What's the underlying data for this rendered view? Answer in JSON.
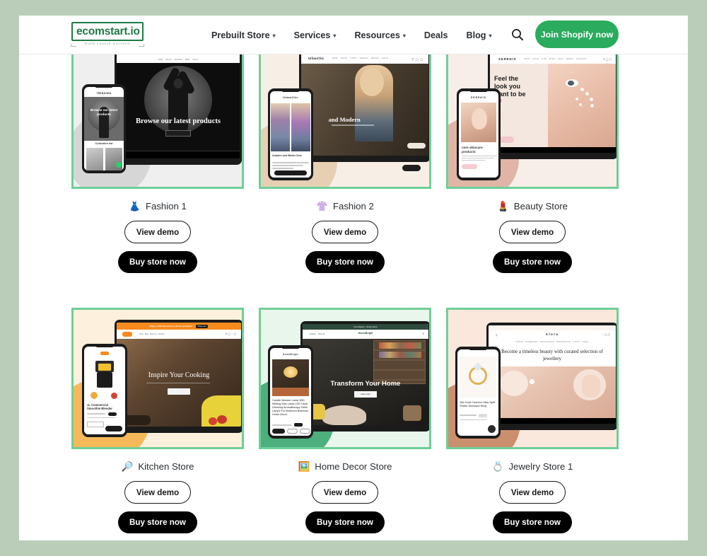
{
  "theme": {
    "page_bg": "#b9cdb9",
    "content_bg": "#ffffff",
    "brand_green": "#1f7a44",
    "cta_green": "#2aab5e",
    "card_border_green": "#6fcf97",
    "button_black": "#000000"
  },
  "header": {
    "logo": {
      "name": "ecomstart.io",
      "tagline": "Build.Launch.Succeed"
    },
    "nav": [
      {
        "label": "Prebuilt Store",
        "has_dropdown": true,
        "caret": "▾"
      },
      {
        "label": "Services",
        "has_dropdown": true,
        "caret": "▾"
      },
      {
        "label": "Resources",
        "has_dropdown": true,
        "caret": "▾"
      },
      {
        "label": "Deals",
        "has_dropdown": false,
        "caret": ""
      },
      {
        "label": "Blog",
        "has_dropdown": true,
        "caret": "▾"
      }
    ],
    "search_icon": "search-icon",
    "cta_label": "Join Shopify now"
  },
  "grid": {
    "view_demo_label": "View demo",
    "buy_store_label": "Buy store now",
    "cards": [
      {
        "id": "fashion-1",
        "emoji": "👗",
        "label": "Fashion 1",
        "store_name": "TRENDORA",
        "hero_text": "Browse our latest products",
        "mobile_text": "Browse our latest products",
        "mobile_section": "Collection list",
        "view_demo": "View demo",
        "buy_store": "Buy store now"
      },
      {
        "id": "fashion-2",
        "emoji": "👚",
        "label": "Fashion 2",
        "store_name": "UrbanChic",
        "hero_text": "and Modern",
        "mobile_text": "Autumn and Winter Sets",
        "mobile_section": "Autumn and Winter Sets",
        "view_demo": "View demo",
        "buy_store": "Buy store now"
      },
      {
        "id": "beauty-store",
        "emoji": "💄",
        "label": "Beauty Store",
        "store_name": "SERENIS",
        "hero_text": "Feel the look you want to be 💗",
        "mobile_text": "core skincare products",
        "mobile_section": "core skincare products",
        "view_demo": "View demo",
        "buy_store": "Buy store now"
      },
      {
        "id": "kitchen-store",
        "emoji": "🔎",
        "label": "Kitchen Store",
        "store_name": "Kitchenly",
        "hero_text": "Inspire Your Cooking",
        "promo_bar": "Enjoy a 10% discount on all our products!",
        "promo_button": "Shop now",
        "mobile_text": "1L Commercial Smoothie Blender",
        "mobile_section": "1L Commercial Smoothie Blender",
        "view_demo": "View demo",
        "buy_store": "Buy store now"
      },
      {
        "id": "home-decor-store",
        "emoji": "🖼️",
        "label": "Home Decor Store",
        "store_name": "HomeBright",
        "hero_text": "Transform Your Home",
        "hero_button": "Learn more",
        "mobile_text": "Candle Warmer Lamp With Melting Wax Lamp LED Lamp Dimming Aromatherapy Table Lamps For Bedroom Bedhead Home Decor",
        "mobile_section": "Candle Warmer Lamp",
        "view_demo": "View demo",
        "buy_store": "Buy store now"
      },
      {
        "id": "jewelry-store-1",
        "emoji": "💍",
        "label": "Jewelry Store 1",
        "store_name": "Alora",
        "hero_text": "Become a timeless beauty with curated selection of jewellery",
        "mobile_text": "18k Gold Cushion Halo Split Shank Diamond Ring",
        "mobile_section": "18k Gold Cushion Halo Split Shank Diamond Ring",
        "view_demo": "View demo",
        "buy_store": "Buy store now"
      }
    ]
  }
}
